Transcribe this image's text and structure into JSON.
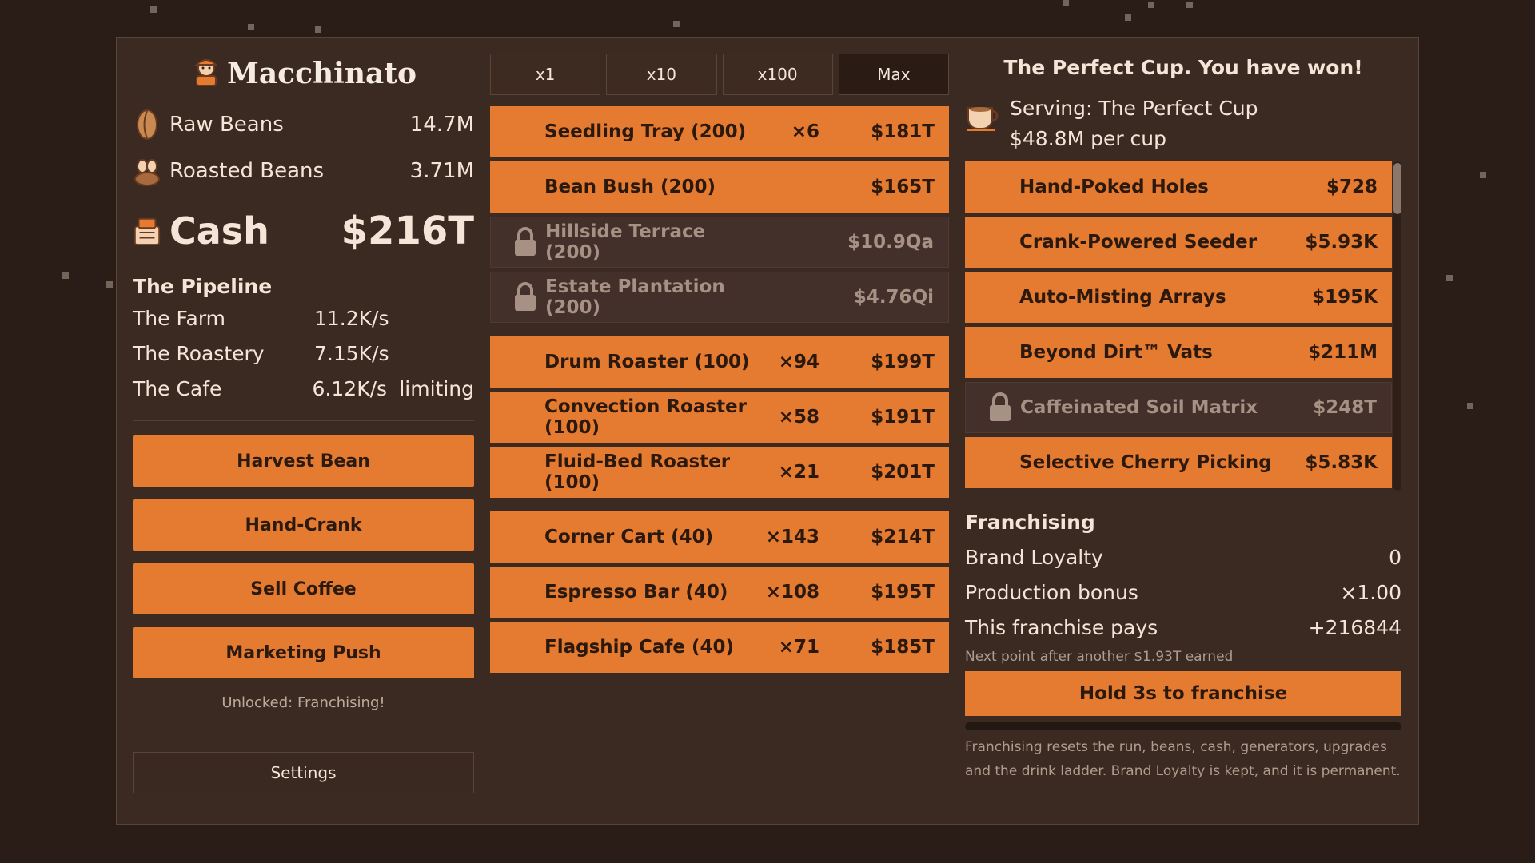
{
  "title": "Macchinato",
  "resources": [
    {
      "icon": "coffee-bean-icon",
      "label": "Raw Beans",
      "value": "14.7M"
    },
    {
      "icon": "roasted-beans-icon",
      "label": "Roasted Beans",
      "value": "3.71M"
    }
  ],
  "cash": {
    "icon": "cash-register-icon",
    "label": "Cash",
    "value": "$216T"
  },
  "pipeline": {
    "heading": "The Pipeline",
    "rows": [
      {
        "name": "The Farm",
        "rate": "11.2K/s",
        "note": ""
      },
      {
        "name": "The Roastery",
        "rate": "7.15K/s",
        "note": ""
      },
      {
        "name": "The Cafe",
        "rate": "6.12K/s",
        "note": "limiting"
      }
    ]
  },
  "actions": [
    "Harvest Bean",
    "Hand-Crank",
    "Sell Coffee",
    "Marketing Push"
  ],
  "unlocked_text": "Unlocked: Franchising!",
  "settings_label": "Settings",
  "multipliers": {
    "options": [
      "x1",
      "x10",
      "x100",
      "Max"
    ],
    "active": "Max"
  },
  "generators": [
    {
      "name": "Seedling Tray (200)",
      "owned": "×6",
      "cost": "$181T",
      "locked": false
    },
    {
      "name": "Bean Bush (200)",
      "owned": "",
      "cost": "$165T",
      "locked": false
    },
    {
      "name": "Hillside Terrace (200)",
      "owned": "",
      "cost": "$10.9Qa",
      "locked": true
    },
    {
      "name": "Estate Plantation (200)",
      "owned": "",
      "cost": "$4.76Qi",
      "locked": true
    },
    {
      "name": "Drum Roaster (100)",
      "owned": "×94",
      "cost": "$199T",
      "locked": false
    },
    {
      "name": "Convection Roaster (100)",
      "owned": "×58",
      "cost": "$191T",
      "locked": false
    },
    {
      "name": "Fluid-Bed Roaster (100)",
      "owned": "×21",
      "cost": "$201T",
      "locked": false
    },
    {
      "name": "Corner Cart (40)",
      "owned": "×143",
      "cost": "$214T",
      "locked": false
    },
    {
      "name": "Espresso Bar (40)",
      "owned": "×108",
      "cost": "$195T",
      "locked": false
    },
    {
      "name": "Flagship Cafe (40)",
      "owned": "×71",
      "cost": "$185T",
      "locked": false
    }
  ],
  "won_text": "The Perfect Cup. You have won!",
  "serving": {
    "line1": "Serving: The Perfect Cup",
    "line2": "$48.8M per cup"
  },
  "upgrades": [
    {
      "name": "Hand-Poked Holes",
      "cost": "$728",
      "locked": false
    },
    {
      "name": "Crank-Powered Seeder",
      "cost": "$5.93K",
      "locked": false
    },
    {
      "name": "Auto-Misting Arrays",
      "cost": "$195K",
      "locked": false
    },
    {
      "name": "Beyond Dirt™ Vats",
      "cost": "$211M",
      "locked": false
    },
    {
      "name": "Caffeinated Soil Matrix",
      "cost": "$248T",
      "locked": true
    },
    {
      "name": "Selective Cherry Picking",
      "cost": "$5.83K",
      "locked": false
    }
  ],
  "franchising": {
    "heading": "Franchising",
    "rows": [
      {
        "label": "Brand Loyalty",
        "value": "0"
      },
      {
        "label": "Production bonus",
        "value": "×1.00"
      },
      {
        "label": "This franchise pays",
        "value": "+216844"
      }
    ],
    "next_text": "Next point after another $1.93T earned",
    "button_label": "Hold 3s to franchise",
    "hold_progress": 0,
    "note": "Franchising resets the run, beans, cash, generators, upgrades and the drink ladder. Brand Loyalty is kept, and it is permanent."
  },
  "colors": {
    "accent": "#e57a31",
    "panel": "#3b2a21",
    "background": "#2a1d17",
    "locked": "#43302a"
  }
}
